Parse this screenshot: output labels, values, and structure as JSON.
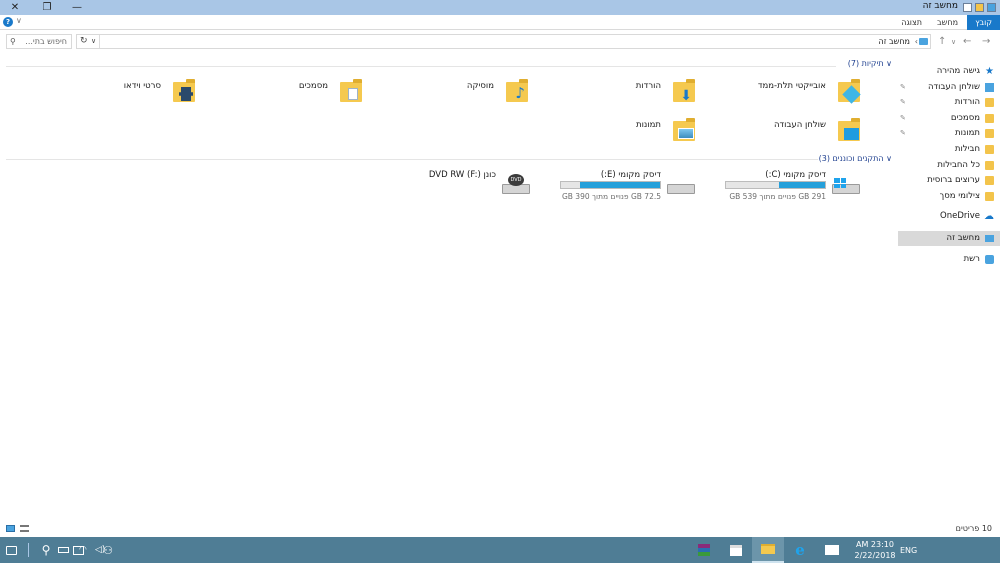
{
  "window": {
    "title": "מחשב זה",
    "minimize_glyph": "—",
    "maximize_glyph": "❐",
    "close_glyph": "✕"
  },
  "ribbon": {
    "tabs": [
      {
        "label": "קובץ",
        "active": true
      },
      {
        "label": "מחשב",
        "active": false
      },
      {
        "label": "תצוגה",
        "active": false
      }
    ],
    "help_glyph": "?",
    "expand_glyph": "∨"
  },
  "address_bar": {
    "path": "מחשב זה",
    "search_placeholder": "חיפוש בתי...",
    "refresh_glyph": "↻",
    "dropdown_glyph": "∨",
    "separator_glyph": "›",
    "back_glyph": "←",
    "forward_glyph": "→",
    "recent_glyph": "∨",
    "up_glyph": "↑"
  },
  "navigation": {
    "items": [
      {
        "label": "גישה מהירה",
        "icon": "star-icon",
        "pinned": false
      },
      {
        "label": "שולחן העבודה",
        "icon": "desktop-folder-icon",
        "pinned": true
      },
      {
        "label": "הורדות",
        "icon": "downloads-folder-icon",
        "pinned": true
      },
      {
        "label": "מסמכים",
        "icon": "documents-folder-icon",
        "pinned": true
      },
      {
        "label": "תמונות",
        "icon": "pictures-folder-icon",
        "pinned": true
      },
      {
        "label": "חבילות",
        "icon": "folder-icon",
        "pinned": false
      },
      {
        "label": "כל החבילות",
        "icon": "folder-icon",
        "pinned": false
      },
      {
        "label": "ערוצים ברוסית",
        "icon": "folder-icon",
        "pinned": false
      },
      {
        "label": "צילומי מסך",
        "icon": "folder-icon",
        "pinned": false
      },
      {
        "label": "OneDrive",
        "icon": "onedrive-icon",
        "pinned": false
      },
      {
        "label": "מחשב זה",
        "icon": "this-pc-icon",
        "pinned": false,
        "selected": true
      },
      {
        "label": "רשת",
        "icon": "network-icon",
        "pinned": false
      }
    ],
    "pin_glyph": "✎"
  },
  "content": {
    "folders_header": "תיקיות (7)",
    "collapse_glyph": "∨",
    "folders": [
      {
        "label": "אובייקטי תלת-ממד",
        "icon": "3d-objects-folder-icon"
      },
      {
        "label": "הורדות",
        "icon": "downloads-folder-icon"
      },
      {
        "label": "מוסיקה",
        "icon": "music-folder-icon"
      },
      {
        "label": "מסמכים",
        "icon": "documents-folder-icon"
      },
      {
        "label": "סרטי וידאו",
        "icon": "videos-folder-icon"
      },
      {
        "label": "שולחן העבודה",
        "icon": "desktop-folder-icon"
      },
      {
        "label": "תמונות",
        "icon": "pictures-folder-icon"
      }
    ],
    "devices_header": "התקנים וכוננים (3)",
    "drives": [
      {
        "name": "דיסק מקומי (C:)",
        "free_text": "291 GB פנויים מתוך 539 GB",
        "used_fraction": 0.46,
        "icon": "windows-drive-icon"
      },
      {
        "name": "דיסק מקומי (E:)",
        "free_text": "72.5 GB פנויים מתוך 390 GB",
        "used_fraction": 0.81,
        "icon": "hard-drive-icon"
      },
      {
        "name": "כונן DVD RW (F:)",
        "icon": "dvd-drive-icon",
        "dvd_label": "DVD"
      }
    ]
  },
  "status_bar": {
    "item_count": "10 פריטים"
  },
  "taskbar": {
    "search_glyph": "⚲",
    "clock_time": "AM 23:10",
    "clock_date": "2/22/2018",
    "language": "ENG"
  },
  "colors": {
    "accent": "#1979ca",
    "titlebar": "#a9c6e6",
    "taskbar": "#4f7d95",
    "drive_bar": "#26a0da",
    "folder": "#f5c94f"
  }
}
